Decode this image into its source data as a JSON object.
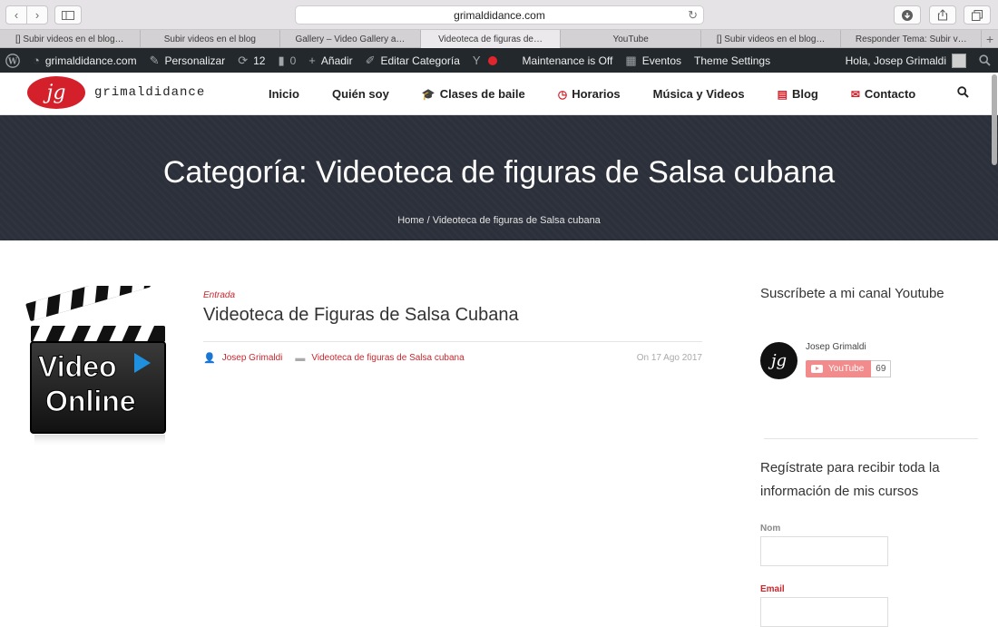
{
  "browser": {
    "url": "grimaldidance.com",
    "tabs": [
      {
        "label": "[] Subir videos en el blog…",
        "active": false
      },
      {
        "label": "Subir videos en el blog",
        "active": false
      },
      {
        "label": "Gallery – Video Gallery a…",
        "active": false
      },
      {
        "label": "Videoteca de figuras de…",
        "active": true
      },
      {
        "label": "YouTube",
        "active": false
      },
      {
        "label": "[] Subir videos en el blog…",
        "active": false
      },
      {
        "label": "Responder Tema: Subir v…",
        "active": false
      }
    ]
  },
  "adminbar": {
    "site": "grimaldidance.com",
    "customize": "Personalizar",
    "updates": "12",
    "comments": "0",
    "add": "Añadir",
    "edit": "Editar Categoría",
    "maintenance": "Maintenance is Off",
    "events": "Eventos",
    "theme": "Theme Settings",
    "greeting": "Hola, Josep Grimaldi"
  },
  "site": {
    "logo_mark": "jg",
    "logo_text": "grimaldidance",
    "nav": [
      {
        "label": "Inicio",
        "icon": ""
      },
      {
        "label": "Quién soy",
        "icon": ""
      },
      {
        "label": "Clases de baile",
        "icon": "🎓"
      },
      {
        "label": "Horarios",
        "icon": "◷"
      },
      {
        "label": "Música y Videos",
        "icon": ""
      },
      {
        "label": "Blog",
        "icon": "▤"
      },
      {
        "label": "Contacto",
        "icon": "✉"
      }
    ]
  },
  "banner": {
    "title": "Categoría: Videoteca de figuras de Salsa cubana",
    "crumb_home": "Home",
    "crumb_sep": " / ",
    "crumb_current": "Videoteca de figuras de Salsa cubana"
  },
  "post": {
    "thumb_line1": "Video",
    "thumb_line2": "Online",
    "type": "Entrada",
    "title": "Videoteca de Figuras de Salsa Cubana",
    "author": "Josep Grimaldi",
    "category": "Videoteca de figuras de Salsa cubana",
    "date": "On 17 Ago 2017"
  },
  "sidebar": {
    "youtube_title": "Suscríbete a mi canal Youtube",
    "channel_avatar": "jg",
    "channel_name": "Josep Grimaldi",
    "subscribe_label": "YouTube",
    "subscriber_count": "69",
    "form_title": "Regístrate para recibir toda la información de mis cursos",
    "name_label": "Nom",
    "email_label": "Email"
  },
  "colors": {
    "accent": "#c8262d",
    "banner_bg": "#2b303a",
    "adminbar_bg": "#23282d"
  }
}
